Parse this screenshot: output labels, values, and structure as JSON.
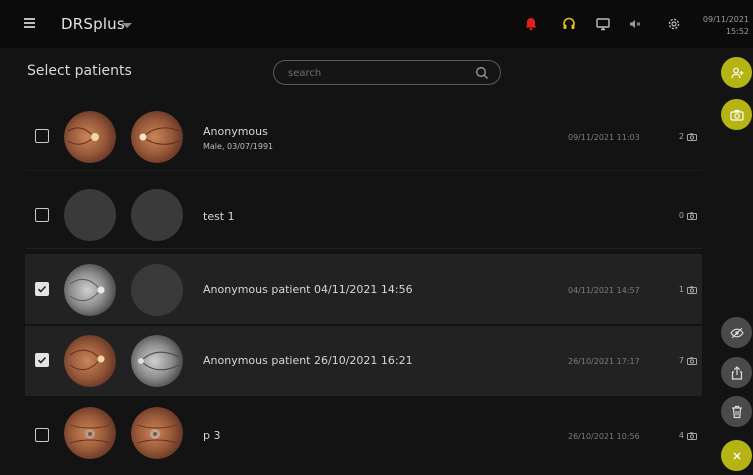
{
  "header": {
    "app_title": "DRSplus",
    "clock": {
      "date": "09/11/2021",
      "time": "15:52"
    },
    "icons": [
      "menu-icon",
      "alarm-bell-icon",
      "headset-icon",
      "monitor-icon",
      "mute-icon",
      "settings-gear-icon"
    ]
  },
  "page": {
    "title": "Select patients"
  },
  "search": {
    "placeholder": "search"
  },
  "patients": [
    {
      "name": "Anonymous",
      "sub": "Male, 03/07/1991",
      "date": "09/11/2021 11:03",
      "count": "2",
      "checked": false,
      "thumb1": "retina-color",
      "thumb2": "retina-color"
    },
    {
      "name": "test 1",
      "sub": "",
      "date": "",
      "count": "0",
      "checked": false,
      "thumb1": "empty",
      "thumb2": "empty"
    },
    {
      "name": "Anonymous patient 04/11/2021 14:56",
      "sub": "",
      "date": "04/11/2021 14:57",
      "count": "1",
      "checked": true,
      "thumb1": "retina-gray",
      "thumb2": "empty"
    },
    {
      "name": "Anonymous patient 26/10/2021 16:21",
      "sub": "",
      "date": "26/10/2021 17:17",
      "count": "7",
      "checked": true,
      "thumb1": "retina-color",
      "thumb2": "retina-gray"
    },
    {
      "name": "p 3",
      "sub": "",
      "date": "26/10/2021 10:56",
      "count": "4",
      "checked": false,
      "thumb1": "retina-color",
      "thumb2": "retina-color"
    }
  ],
  "actions": {
    "top": [
      "add-patient-icon",
      "camera-icon"
    ],
    "bottom": [
      "hide-eye-icon",
      "share-icon",
      "trash-icon",
      "close-icon"
    ]
  },
  "colors": {
    "accent": "#b6b314",
    "alert": "#e02020",
    "headset": "#e8c11a",
    "selected_row": "#222222"
  }
}
